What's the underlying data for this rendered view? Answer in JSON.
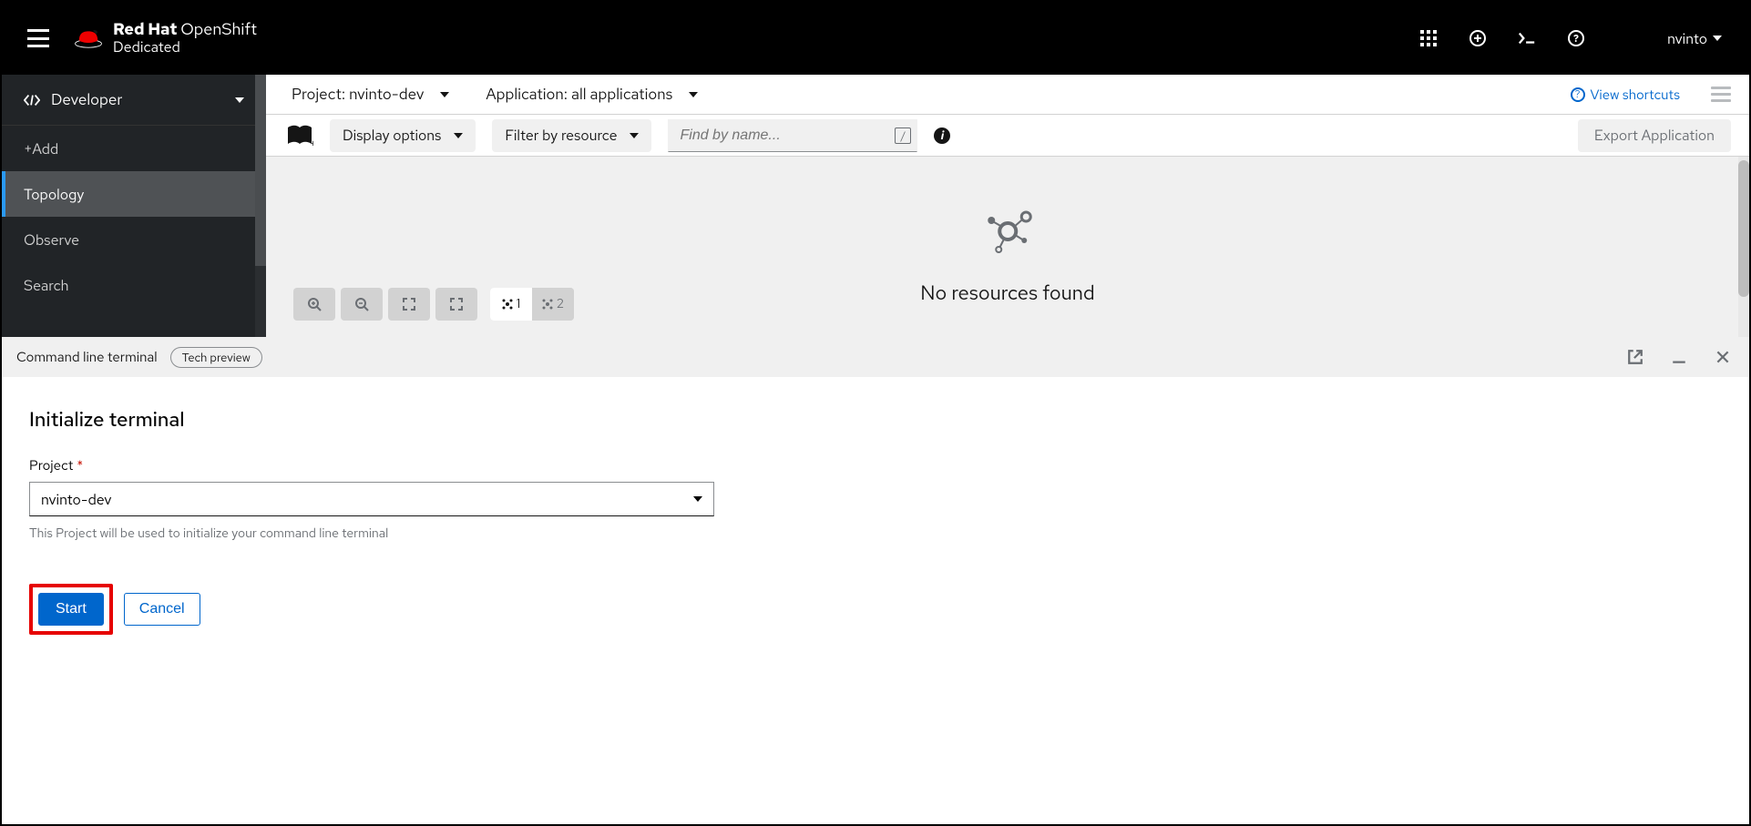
{
  "brand": {
    "line1a": "Red Hat",
    "line1b": "OpenShift",
    "line2": "Dedicated"
  },
  "user": "nvinto",
  "perspective": "Developer",
  "nav": [
    "+Add",
    "Topology",
    "Observe",
    "Search"
  ],
  "nav_active_index": 1,
  "project_selector": {
    "prefix": "Project:",
    "value": "nvinto-dev"
  },
  "app_selector": {
    "prefix": "Application:",
    "value": "all applications"
  },
  "shortcuts_link": "View shortcuts",
  "toolbar": {
    "display_options": "Display options",
    "filter_by_resource": "Filter by resource",
    "find_placeholder": "Find by name...",
    "slash_key": "/",
    "export": "Export Application"
  },
  "empty_state": "No resources found",
  "layout_buttons": {
    "one": "1",
    "two": "2"
  },
  "terminal": {
    "header": "Command line terminal",
    "badge": "Tech preview",
    "title": "Initialize terminal",
    "field_label": "Project",
    "select_value": "nvinto-dev",
    "hint": "This Project will be used to initialize your command line terminal",
    "start": "Start",
    "cancel": "Cancel"
  }
}
